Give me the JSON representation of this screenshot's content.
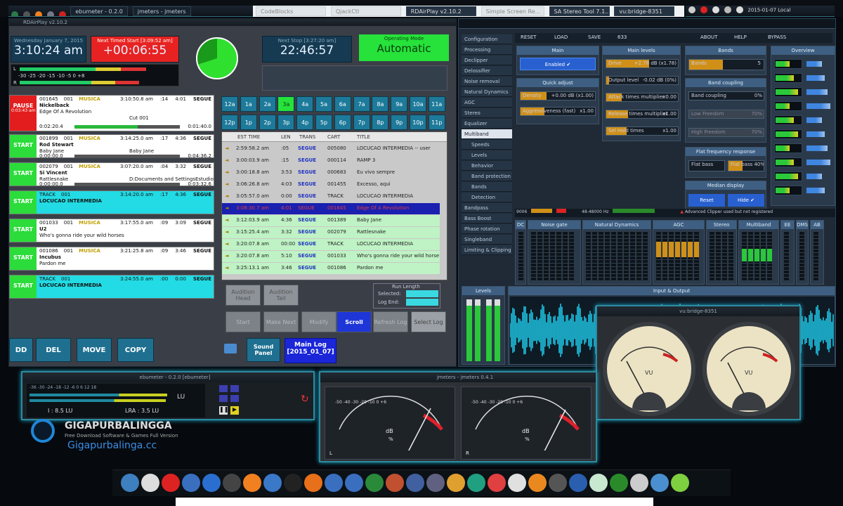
{
  "top_bar": {
    "tabs": [
      "ebumeter - 0.2.0",
      "jmeters - jmeters",
      "CodeBlocks",
      "QjackCtl",
      "RDAirPlay v2.10.2",
      "Simple Screen Re...",
      "SA Stereo Tool 7.1...",
      "vu:bridge-8351"
    ],
    "clock": "2015-01-07 Local"
  },
  "rdairplay": {
    "title": "RDAirPlay v2.10.2",
    "clock_label": "Wednesday January 7, 2015",
    "clock": "3:10:24 am",
    "next_timed_label": "Next Timed Start [3:09:52 am]",
    "next_timed": "+00:06:55",
    "next_stop_label": "Next Stop [3:27:20 am]",
    "next_stop": "22:46:57",
    "op_mode_label": "Operating Mode",
    "op_mode": "Automatic",
    "meter_scale": "-30  -25  -20  -15  -10  -5  0  +8",
    "meter_l": "L",
    "meter_r": "R",
    "carts": [
      {
        "btn": "PAUSE",
        "btn_color": "#e31d1d",
        "sub": "0:03:43 am",
        "cart": "001645",
        "num": "001",
        "group": "MUSICA",
        "time": "3:10:50.8 am",
        "len": ":14",
        "total": "4:01",
        "trans": "SEGUE",
        "artist": "Nickelback",
        "title": "Edge Of A Revolution",
        "cut": "Cut 001",
        "pos": "0:02:20.4",
        "rem": "0:01:40.0",
        "bg": "#fff"
      },
      {
        "btn": "START",
        "btn_color": "#2bdc3a",
        "sub": "",
        "cart": "001899",
        "num": "001",
        "group": "MUSICA",
        "time": "3:14:25.0 am",
        "len": ":17",
        "total": "4:36",
        "trans": "SEGUE",
        "artist": "Rod Stewart",
        "title": "Baby Jane",
        "cut": "Baby Jane",
        "pos": "0:00:00.0",
        "rem": "0:04:36.2",
        "bg": "#fff"
      },
      {
        "btn": "START",
        "btn_color": "#2bdc3a",
        "sub": "",
        "cart": "002079",
        "num": "001",
        "group": "MUSICA",
        "time": "3:07:20.0 am",
        "len": ":04",
        "total": "3:32",
        "trans": "SEGUE",
        "artist": "Si Vincent",
        "title": "Rattlesnake",
        "cut": "D:Documents and SettingsEstudio",
        "pos": "0:00:00.0",
        "rem": "0:03:32.6",
        "bg": "#fff"
      },
      {
        "btn": "START",
        "btn_color": "#2bdc3a",
        "sub": "",
        "cart": "TRACK",
        "num": "001",
        "group": "",
        "time": "3:14:20.0 am",
        "len": ":17",
        "total": "4:36",
        "trans": "SEGUE",
        "artist": "LOCUCAO INTERMEDIA",
        "title": "",
        "cut": "",
        "pos": "",
        "rem": "",
        "bg": "#22dbe4"
      },
      {
        "btn": "START",
        "btn_color": "#2bdc3a",
        "sub": "",
        "cart": "001033",
        "num": "001",
        "group": "MUSICA",
        "time": "3:17:55.0 am",
        "len": ":09",
        "total": "3:09",
        "trans": "SEGUE",
        "artist": "U2",
        "title": "Who's gonna ride your wild horses",
        "cut": "",
        "pos": "",
        "rem": "",
        "bg": "#fff"
      },
      {
        "btn": "START",
        "btn_color": "#2bdc3a",
        "sub": "",
        "cart": "001086",
        "num": "001",
        "group": "MUSICA",
        "time": "3:21:25.8 am",
        "len": ":09",
        "total": "3:46",
        "trans": "SEGUE",
        "artist": "Incubus",
        "title": "Pardon me",
        "cut": "",
        "pos": "",
        "rem": "",
        "bg": "#fff"
      },
      {
        "btn": "START",
        "btn_color": "#2bdc3a",
        "sub": "",
        "cart": "TRACK",
        "num": "001",
        "group": "",
        "time": "3:24:55.0 am",
        "len": ":00",
        "total": "0:00",
        "trans": "SEGUE",
        "artist": "LOCUCAO INTERMEDIA",
        "title": "",
        "cut": "",
        "pos": "",
        "rem": "",
        "bg": "#22dbe4"
      }
    ],
    "hours_row1": [
      "12a",
      "1a",
      "2a",
      "3a",
      "4a",
      "5a",
      "6a",
      "7a",
      "8a",
      "9a",
      "10a",
      "11a"
    ],
    "hours_row2": [
      "12p",
      "1p",
      "2p",
      "3p",
      "4p",
      "5p",
      "6p",
      "7p",
      "8p",
      "9p",
      "10p",
      "11p"
    ],
    "log_headers": [
      "EST TIME",
      "LEN",
      "TRANS",
      "CART",
      "TITLE"
    ],
    "log_rows": [
      {
        "time": "2:59:58.2 am",
        "len": ":05",
        "trans": "SEGUE",
        "cart": "005080",
        "title": "LOCUCAO INTERMEDIA -- user",
        "bg": "#c9c9c9"
      },
      {
        "time": "3:00:03.9 am",
        "len": ":15",
        "trans": "SEGUE",
        "cart": "000114",
        "title": "RAMP 3",
        "bg": "#c9c9c9"
      },
      {
        "time": "3:00:18.8 am",
        "len": "3:53",
        "trans": "SEGUE",
        "cart": "000683",
        "title": "Eu vivo sempre",
        "bg": "#c9c9c9"
      },
      {
        "time": "3:06:26.8 am",
        "len": "4:03",
        "trans": "SEGUE",
        "cart": "001455",
        "title": "Excesso, aqui",
        "bg": "#c9c9c9"
      },
      {
        "time": "3:05:57.0 am",
        "len": "0:00",
        "trans": "SEGUE",
        "cart": "TRACK",
        "title": "LOCUCAO INTERMEDIA",
        "bg": "#c9c9c9"
      },
      {
        "time": "3:08:30.7 am",
        "len": "4:01",
        "trans": "SEGUE",
        "cart": "001645",
        "title": "Edge Of A Revolution",
        "bg": "#1a20b0"
      },
      {
        "time": "3:12:03.9 am",
        "len": "4:36",
        "trans": "SEGUE",
        "cart": "001389",
        "title": "Baby Jane",
        "bg": "#bff2c4"
      },
      {
        "time": "3:15:25.4 am",
        "len": "3:32",
        "trans": "SEGUE",
        "cart": "002079",
        "title": "Rattlesnake",
        "bg": "#bff2c4"
      },
      {
        "time": "3:20:07.8 am",
        "len": "00:00",
        "trans": "SEGUE",
        "cart": "TRACK",
        "title": "LOCUCAO INTERMEDIA",
        "bg": "#bff2c4"
      },
      {
        "time": "3:20:07.8 am",
        "len": "5:10",
        "trans": "SEGUE",
        "cart": "001033",
        "title": "Who's gonna ride your wild horse",
        "bg": "#bff2c4"
      },
      {
        "time": "3:25:13.1 am",
        "len": "3:46",
        "trans": "SEGUE",
        "cart": "001086",
        "title": "Pardon me",
        "bg": "#bff2c4"
      }
    ],
    "audition_head": "Audition Head",
    "audition_tail": "Audition Tail",
    "run_length": "Run Length",
    "selected": "Selected:",
    "log_end": "Log End:",
    "start": "Start",
    "make_next": "Make Next",
    "modify": "Modify",
    "scroll": "Scroll",
    "refresh_log": "Refresh Log",
    "select_log": "Select Log",
    "add": "DD",
    "del": "DEL",
    "move": "MOVE",
    "copy": "COPY",
    "sound_panel": "Sound Panel",
    "main_log": "Main Log",
    "main_log_date": "[2015_01_07]"
  },
  "stereotool": {
    "toolbar": [
      "RESET",
      "LOAD",
      "SAVE",
      "633",
      "ABOUT",
      "HELP",
      "BYPASS"
    ],
    "menu": [
      "Configuration",
      "Processing",
      "Declipper",
      "Delossifier",
      "Noise removal",
      "Natural Dynamics",
      "AGC",
      "Stereo",
      "Equalizer",
      "Multiband",
      "Speeds",
      "Levels",
      "Behavior",
      "Band protection",
      "Bands",
      "Detection",
      "Bandpass",
      "Bass Boost",
      "Phase rotation",
      "Singleband",
      "Limiting & Clipping"
    ],
    "main_title": "Main",
    "enabled": "Enabled",
    "main_levels_title": "Main levels",
    "drive": "Drive",
    "drive_value": "+2.78 dB (x1.78)",
    "output_level": "Output level",
    "output_value": "-0.02 dB (0%)",
    "attack": "Attack times multiplier",
    "attack_value": "x0.00",
    "release": "Release times multiplier",
    "release_value": "x1.00",
    "sel_hold": "Sel Hold times",
    "sel_hold_value": "x1.00",
    "quick_adjust_title": "Quick adjust",
    "density": "Density",
    "density_value": "+0.00 dB (x1.00)",
    "aggressiveness": "Aggressiveness (fast)",
    "aggressiveness_value": "x1.00",
    "bands_title": "Bands",
    "bands_value": "Bands",
    "bands_num": "5",
    "band_coupling_title": "Band coupling",
    "band_coupling": "Band coupling",
    "band_coupling_value": "0%",
    "low_freedom": "Low Freedom",
    "low_freedom_value": "70%",
    "high_freedom": "High Freedom",
    "high_freedom_value": "70%",
    "flat_title": "Flat frequency response",
    "flat_bass": "Flat bass",
    "flat_value": "Flat bass 40%",
    "median_title": "Median display",
    "reset": "Reset",
    "hide": "Hide",
    "overview_title": "Overview",
    "status_text": "Advanced Clipper used but not registered",
    "status_freq": "48-48000 Hz",
    "status_num": "9006",
    "section_labels": [
      "DC",
      "Noise gate",
      "Natural Dynamics",
      "AGC",
      "Stereo",
      "Multiband",
      "EE",
      "DMS",
      "AB"
    ],
    "levels_title": "Levels",
    "io_title": "Input & Output"
  },
  "vubridge": {
    "title": "vu:bridge-8351",
    "label_l": "VU",
    "label_r": "VU"
  },
  "ebumeter": {
    "title": "ebumeter - 0.2.0 [ebumeter]",
    "scale": "-36  -30  -24  -18  -12  -6  0  6  12  18",
    "lu_label": "LU",
    "i_value": "I :  8.5 LU",
    "lra_value": "LRA :  3.5 LU"
  },
  "jmeters": {
    "title": "jmeters - jmeters 0.4.1",
    "dial_scale": "-50 -40 -30 -20 -10 0 +6",
    "db_label": "dB",
    "pct": "%",
    "ch_l": "L",
    "ch_r": "R"
  },
  "watermark": {
    "brand": "GIGAPURBALINGGA",
    "tagline": "Free Download Software & Games Full Version",
    "url": "Gigapurbalinga.cc"
  },
  "dock": [
    "anchor",
    "gimp",
    "acrobat",
    "photo",
    "safari",
    "search",
    "vlc",
    "mail",
    "terminal",
    "firefox",
    "writer1",
    "writer2",
    "calc",
    "impress",
    "draw",
    "math",
    "files",
    "audio",
    "settings",
    "media",
    "music",
    "sliders",
    "monitor",
    "chart",
    "ebu",
    "speedo",
    "trash",
    "orb"
  ]
}
